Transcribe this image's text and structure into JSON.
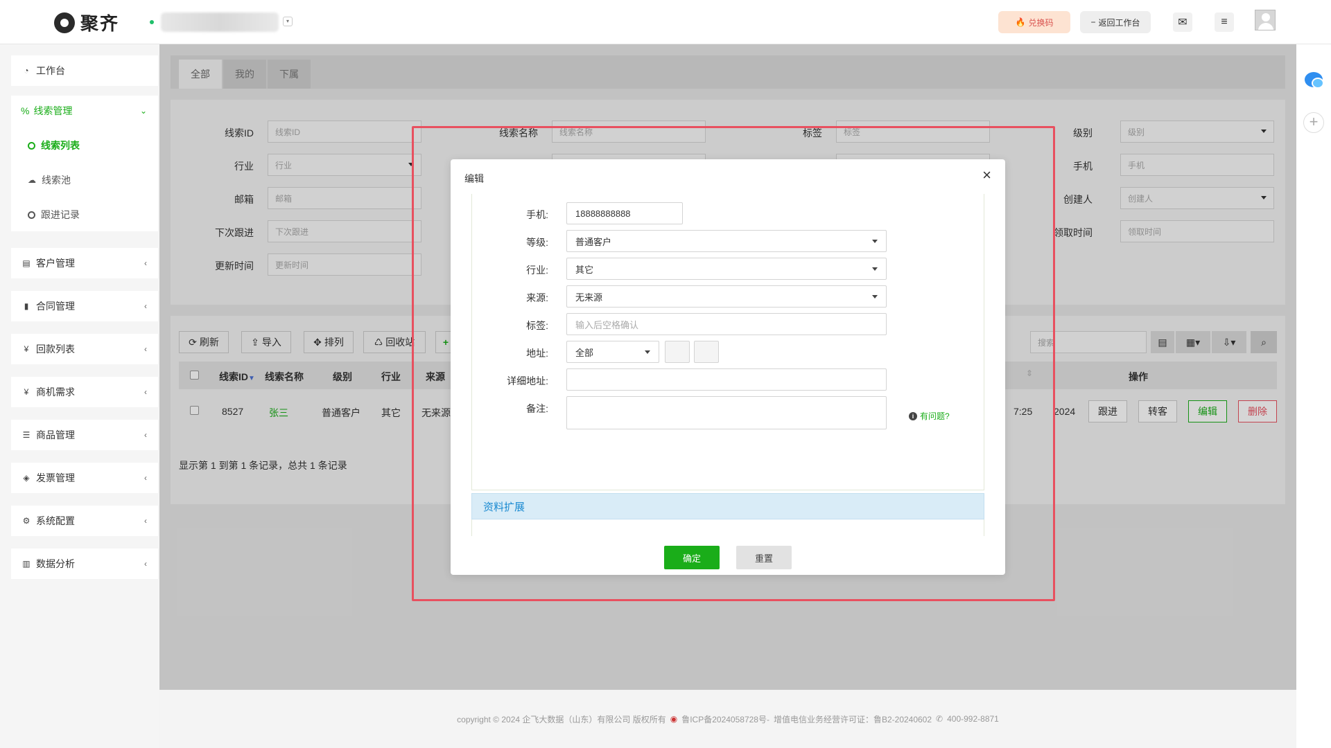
{
  "topbar": {
    "logo_text": "聚齐",
    "redeem_label": "兑换码",
    "back_label": "返回工作台"
  },
  "sidebar": {
    "workbench": "工作台",
    "leads": {
      "label": "线索管理",
      "items": [
        "线索列表",
        "线索池",
        "跟进记录"
      ]
    },
    "groups": [
      "客户管理",
      "合同管理",
      "回款列表",
      "商机需求",
      "商品管理",
      "发票管理",
      "系统配置",
      "数据分析"
    ]
  },
  "tabs": [
    "全部",
    "我的",
    "下属"
  ],
  "filters": {
    "lead_id": {
      "label": "线索ID",
      "placeholder": "线索ID"
    },
    "lead_name": {
      "label": "线索名称",
      "placeholder": "线索名称"
    },
    "tag": {
      "label": "标签",
      "placeholder": "标签"
    },
    "level": {
      "label": "级别",
      "placeholder": "级别"
    },
    "industry": {
      "label": "行业",
      "placeholder": "行业"
    },
    "phone": {
      "label": "手机",
      "placeholder": "手机"
    },
    "email": {
      "label": "邮箱",
      "placeholder": "邮箱"
    },
    "creator": {
      "label": "创建人",
      "placeholder": "创建人"
    },
    "next_follow": {
      "label": "下次跟进",
      "placeholder": "下次跟进"
    },
    "claim_time": {
      "label": "领取时间",
      "placeholder": "领取时间"
    },
    "update_time": {
      "label": "更新时间",
      "placeholder": "更新时间"
    }
  },
  "toolbar": {
    "refresh": "刷新",
    "import": "导入",
    "sort": "排列",
    "recycle": "回收站",
    "search_placeholder": "搜索"
  },
  "table": {
    "headers": [
      "线索ID",
      "线索名称",
      "级别",
      "行业",
      "来源",
      "操作"
    ],
    "row": {
      "id": "8527",
      "name": "张三",
      "level": "普通客户",
      "industry": "其它",
      "source": "无来源",
      "time_fragment": "7:25",
      "year_fragment": "2024"
    },
    "actions": [
      "跟进",
      "转客",
      "编辑",
      "删除"
    ],
    "summary": "显示第 1 到第 1 条记录，总共 1 条记录"
  },
  "modal": {
    "title": "编辑",
    "fields": {
      "phone": {
        "label": "手机:",
        "value": "18888888888"
      },
      "grade": {
        "label": "等级:",
        "value": "普通客户"
      },
      "industry": {
        "label": "行业:",
        "value": "其它"
      },
      "source": {
        "label": "来源:",
        "value": "无来源"
      },
      "tag": {
        "label": "标签:",
        "placeholder": "输入后空格确认"
      },
      "address": {
        "label": "地址:",
        "value": "全部"
      },
      "detail_address": {
        "label": "详细地址:",
        "value": ""
      },
      "remark": {
        "label": "备注:",
        "value": ""
      }
    },
    "help_link": "有问题?",
    "section_title": "资料扩展",
    "ok_label": "确定",
    "reset_label": "重置"
  },
  "footer": {
    "copyright": "copyright © 2024 企飞大数据（山东）有限公司 版权所有",
    "icp": "鲁ICP备2024058728号-",
    "license": "增值电信业务经营许可证：鲁B2-20240602",
    "phone": "400-992-8871"
  },
  "colors": {
    "accent": "#1aad19",
    "danger": "#e8505f",
    "section_blue": "#1a8ad1"
  }
}
